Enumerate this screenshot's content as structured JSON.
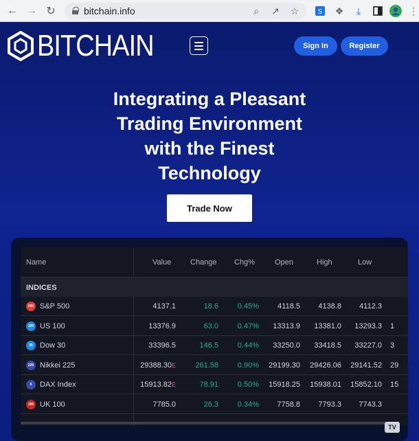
{
  "browser": {
    "url": "bitchain.info"
  },
  "site": {
    "logo_text": "BITCHAIN",
    "sign_in": "Sign In",
    "register": "Register",
    "hero_lines": [
      "Integrating a Pleasant",
      "Trading Environment",
      "with the Finest",
      "Technology"
    ],
    "cta": "Trade Now"
  },
  "ticker": {
    "columns": [
      "Name",
      "Value",
      "Change",
      "Chg%",
      "Open",
      "High",
      "Low"
    ],
    "section": "INDICES",
    "rows": [
      {
        "badge": "500",
        "badge_color": "#e53935",
        "name": "S&P 500",
        "value": "4137.1",
        "change": "18.6",
        "chg": "0.45%",
        "open": "4118.5",
        "high": "4138.8",
        "low": "4112.3",
        "extra": ""
      },
      {
        "badge": "100",
        "badge_color": "#1e88e5",
        "name": "US 100",
        "value": "13376.9",
        "change": "63.0",
        "chg": "0.47%",
        "open": "13313.9",
        "high": "13381.0",
        "low": "13293.3",
        "extra": "1"
      },
      {
        "badge": "30",
        "badge_color": "#1e88e5",
        "name": "Dow 30",
        "value": "33396.5",
        "change": "146.5",
        "chg": "0.44%",
        "open": "33250.0",
        "high": "33418.5",
        "low": "33227.0",
        "extra": "3"
      },
      {
        "badge": "225",
        "badge_color": "#3949ab",
        "name": "Nikkei 225",
        "value": "29388.30",
        "change": "261.58",
        "chg": "0.90%",
        "open": "29199.30",
        "high": "29426.06",
        "low": "29141.52",
        "extra": "29"
      },
      {
        "badge": "X",
        "badge_color": "#3949ab",
        "name": "DAX Index",
        "value": "15913.82",
        "change": "78.91",
        "chg": "0.50%",
        "open": "15918.25",
        "high": "15938.01",
        "low": "15852.10",
        "extra": "15"
      },
      {
        "badge": "100",
        "badge_color": "#c62828",
        "name": "UK 100",
        "value": "7785.0",
        "change": "26.3",
        "chg": "0.34%",
        "open": "7758.8",
        "high": "7793.3",
        "low": "7743.3",
        "extra": ""
      }
    ],
    "e_marker": "E"
  },
  "colors": {
    "positive": "#22ab94",
    "button": "#1f5fe0",
    "page_bg": "#0f2490"
  }
}
